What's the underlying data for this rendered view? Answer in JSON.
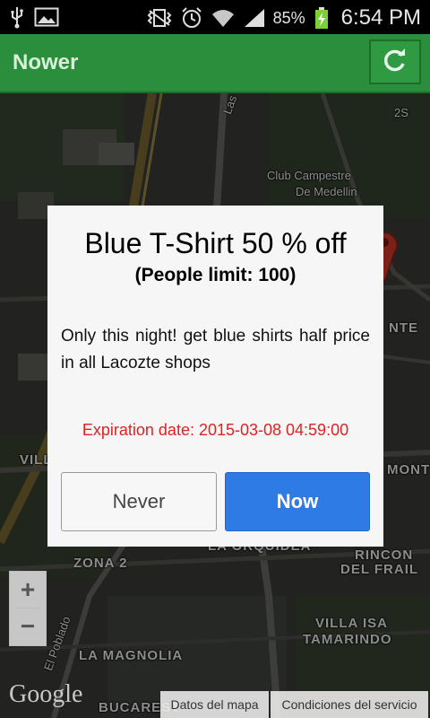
{
  "status_bar": {
    "battery_percent": "85%",
    "time": "6:54 PM",
    "icons": [
      "usb-icon",
      "image-icon",
      "vibrate-icon",
      "alarm-icon",
      "wifi-icon",
      "signal-icon",
      "battery-icon"
    ]
  },
  "app_bar": {
    "title": "Nower",
    "refresh_icon": "refresh-icon",
    "color": "#2a8e3c"
  },
  "map": {
    "labels": {
      "las_vegas": "Las Vegas",
      "club": "Club Campestre",
      "club2": "De Medellin",
      "villagrande": "VILLAGRANDE",
      "zona2": "ZONA 2",
      "la_orquidea": "LA ORQUIDEA",
      "rincon": "RINCON",
      "del_fraile": "DEL FRAIL",
      "villa_isa": "VILLA ISA",
      "tamarindo": "TAMARINDO",
      "la_magnolia": "LA MAGNOLIA",
      "el_poblado": "El Poblado",
      "nte": "NTE",
      "mont": "MONT",
      "bucarest": "BUCAREST",
      "st2": "2S"
    },
    "zoom_in": "+",
    "zoom_out": "−",
    "google_logo": "Google",
    "map_data_link": "Datos del mapa",
    "terms_link": "Condiciones del servicio"
  },
  "dialog": {
    "title": "Blue T-Shirt 50 % off",
    "subtitle": "(People limit: 100)",
    "body": "Only this night! get blue shirts half price in all Lacozte shops",
    "expiration": "Expiration date: 2015-03-08 04:59:00",
    "never_label": "Never",
    "now_label": "Now",
    "colors": {
      "expiration": "#e02222",
      "now_button": "#2f7be6"
    }
  }
}
